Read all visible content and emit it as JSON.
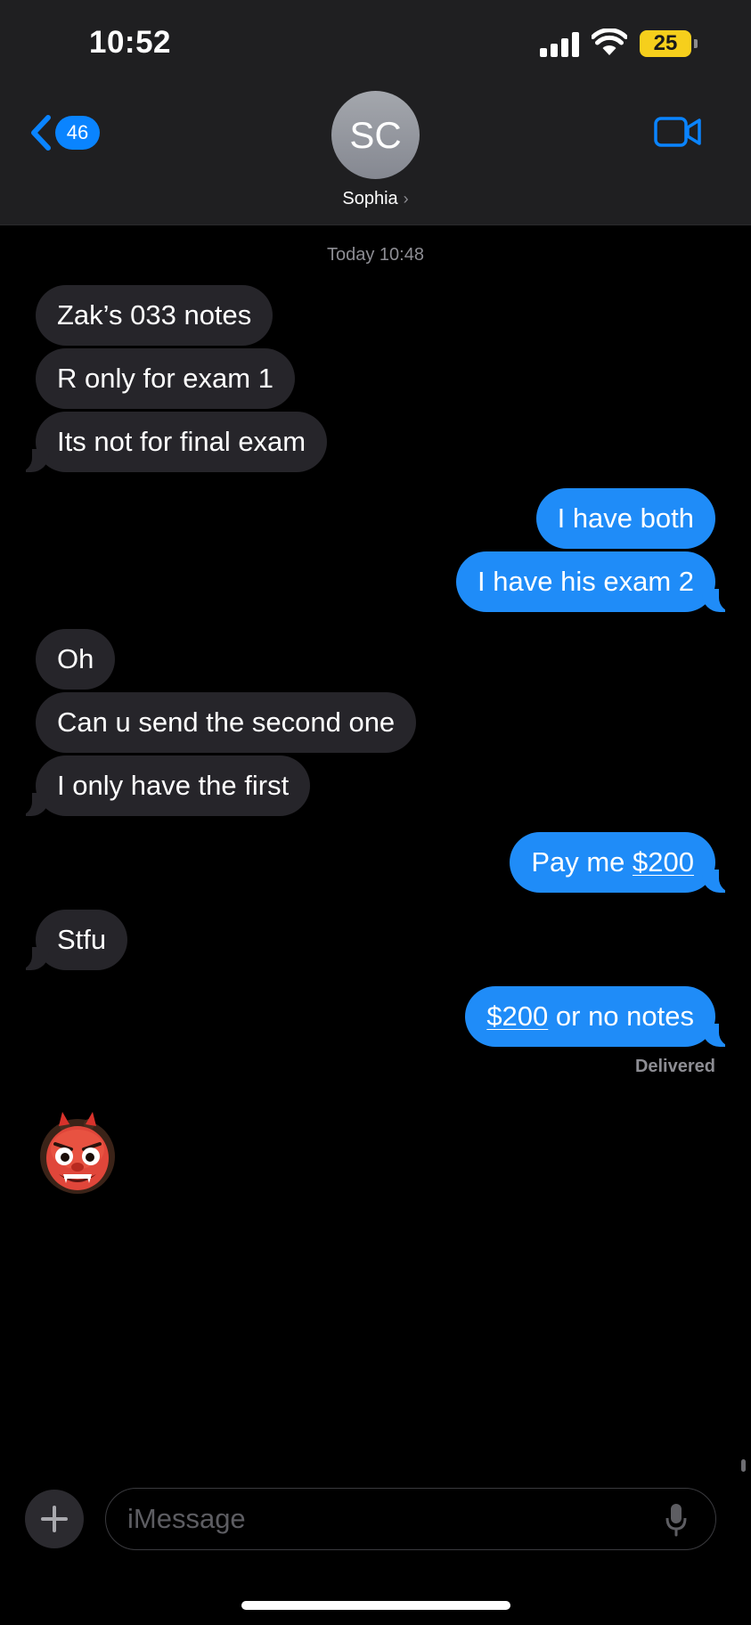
{
  "status_bar": {
    "time": "10:52",
    "battery": "25"
  },
  "header": {
    "back_count": "46",
    "avatar_initials": "SC",
    "contact_name": "Sophia"
  },
  "thread": {
    "timestamp": "Today 10:48",
    "messages": [
      {
        "from": "them",
        "text": "Zak’s 033 notes"
      },
      {
        "from": "them",
        "text": "R only for exam 1"
      },
      {
        "from": "them",
        "text": "Its not for final exam"
      },
      {
        "from": "me",
        "text": "I have both"
      },
      {
        "from": "me",
        "text": "I have his exam 2"
      },
      {
        "from": "them",
        "text": "Oh"
      },
      {
        "from": "them",
        "text": "Can u send the second one"
      },
      {
        "from": "them",
        "text": "I only have the first"
      },
      {
        "from": "me",
        "text_prefix": "Pay me ",
        "link": "$200"
      },
      {
        "from": "them",
        "text": "Stfu"
      },
      {
        "from": "me",
        "link": "$200",
        "text_suffix": " or no notes"
      }
    ],
    "delivered_label": "Delivered",
    "reaction_emoji": "ogre-emoji"
  },
  "composer": {
    "placeholder": "iMessage"
  },
  "colors": {
    "sent_bubble": "#1f8cf8",
    "received_bubble": "#26252a",
    "accent": "#0a84ff",
    "battery": "#f6cf1c"
  },
  "icons": [
    "back-chevron-icon",
    "video-camera-icon",
    "plus-icon",
    "microphone-icon",
    "signal-icon",
    "wifi-icon"
  ]
}
